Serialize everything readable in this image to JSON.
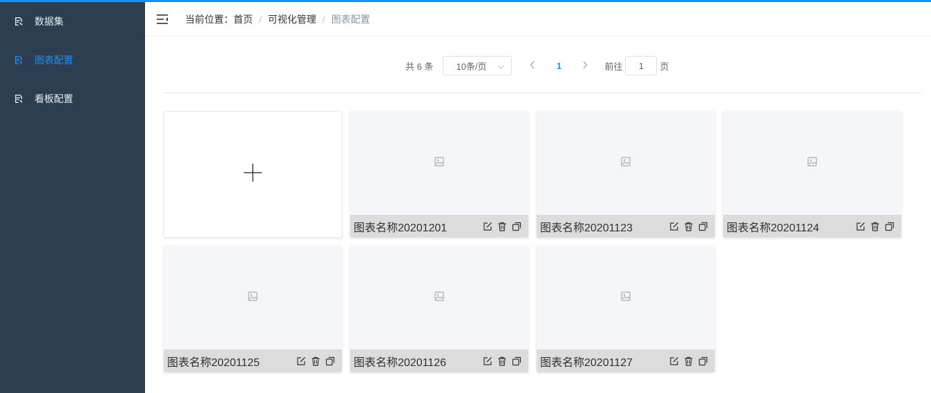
{
  "sidebar": {
    "items": [
      {
        "label": "数据集",
        "icon": "document-edit-icon",
        "active": false
      },
      {
        "label": "图表配置",
        "icon": "document-edit-icon",
        "active": true
      },
      {
        "label": "看板配置",
        "icon": "document-edit-icon",
        "active": false
      }
    ]
  },
  "header": {
    "breadcrumb": {
      "prefix": "当前位置：",
      "home": "首页",
      "sep1": "/",
      "section": "可视化管理",
      "sep2": "/",
      "current": "图表配置"
    }
  },
  "pagination": {
    "total": "共 6 条",
    "page_size": "10条/页",
    "current_page": "1",
    "goto_label": "前往",
    "goto_value": "1",
    "goto_suffix": "页"
  },
  "cards": [
    {
      "name": "图表名称20201201"
    },
    {
      "name": "图表名称20201123"
    },
    {
      "name": "图表名称20201124"
    },
    {
      "name": "图表名称20201125"
    },
    {
      "name": "图表名称20201126"
    },
    {
      "name": "图表名称20201127"
    }
  ],
  "colors": {
    "accent": "#1890ff",
    "sidebar_bg": "#2d3e50"
  }
}
